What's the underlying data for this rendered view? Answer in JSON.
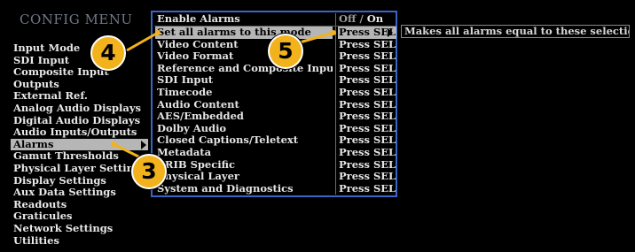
{
  "config_menu": {
    "title": "CONFIG MENU",
    "items": [
      {
        "label": "Input Mode"
      },
      {
        "label": "SDI Input"
      },
      {
        "label": "Composite Input"
      },
      {
        "label": "Outputs"
      },
      {
        "label": "External Ref."
      },
      {
        "label": "Analog Audio Displays"
      },
      {
        "label": "Digital Audio Displays"
      },
      {
        "label": "Audio Inputs/Outputs"
      },
      {
        "label": "Alarms",
        "selected": true
      },
      {
        "label": "Gamut Thresholds"
      },
      {
        "label": "Physical Layer Settings"
      },
      {
        "label": "Display Settings"
      },
      {
        "label": "Aux Data Settings"
      },
      {
        "label": "Readouts"
      },
      {
        "label": "Graticules"
      },
      {
        "label": "Network Settings"
      },
      {
        "label": "Utilities"
      }
    ]
  },
  "alarms_submenu": {
    "header": {
      "label": "Enable Alarms",
      "value_off": "Off",
      "value_sep": " / ",
      "value_on": "On"
    },
    "rows": [
      {
        "label": "Set all alarms to this mode",
        "value": "Press SEL",
        "selected": true
      },
      {
        "label": "Video Content",
        "value": "Press SEL"
      },
      {
        "label": "Video Format",
        "value": "Press SEL"
      },
      {
        "label": "Reference and Composite Input",
        "value": "Press SEL"
      },
      {
        "label": "SDI Input",
        "value": "Press SEL"
      },
      {
        "label": "Timecode",
        "value": "Press SEL"
      },
      {
        "label": "Audio Content",
        "value": "Press SEL"
      },
      {
        "label": "AES/Embedded",
        "value": "Press SEL"
      },
      {
        "label": "Dolby Audio",
        "value": "Press SEL"
      },
      {
        "label": "Closed Captions/Teletext",
        "value": "Press SEL"
      },
      {
        "label": "Metadata",
        "value": "Press SEL"
      },
      {
        "label": "ARIB Specific",
        "value": "Press SEL"
      },
      {
        "label": "Physical Layer",
        "value": "Press SEL"
      },
      {
        "label": "System and Diagnostics",
        "value": "Press SEL"
      }
    ]
  },
  "help_text": "Makes all alarms equal to these selections",
  "callouts": {
    "three": "3",
    "four": "4",
    "five": "5"
  },
  "colors": {
    "background": "#000000",
    "selection": "#b6b6b6",
    "submenu_border": "#3a64c6",
    "callout_fill": "#f2b21c",
    "title_text": "#6f7789"
  }
}
